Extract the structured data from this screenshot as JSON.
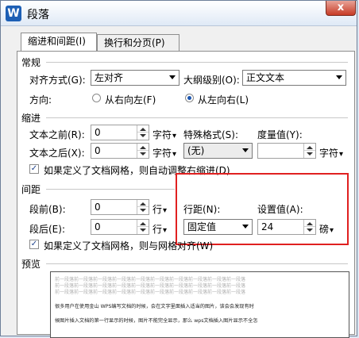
{
  "window": {
    "icon_letter": "W",
    "title": "段落",
    "close_label": "x"
  },
  "tabs": [
    {
      "label": "缩进和间距(I)",
      "active": true
    },
    {
      "label": "换行和分页(P)",
      "active": false
    }
  ],
  "general": {
    "section_label": "常规",
    "align_label": "对齐方式(G):",
    "align_value": "左对齐",
    "outline_label": "大纲级别(O):",
    "outline_value": "正文文本",
    "direction_label": "方向:",
    "rtl_label": "从右向左(F)",
    "ltr_label": "从左向右(L)",
    "direction_selected": "ltr"
  },
  "indent": {
    "section_label": "缩进",
    "before_label": "文本之前(R):",
    "before_value": "0",
    "before_unit": "字符",
    "after_label": "文本之后(X):",
    "after_value": "0",
    "after_unit": "字符",
    "special_label": "特殊格式(S):",
    "special_value": "(无)",
    "measure_label": "度量值(Y):",
    "measure_value": "",
    "measure_unit": "字符",
    "auto_adjust_label": "如果定义了文档网格，则自动调整右缩进(D)",
    "auto_adjust_checked": true
  },
  "spacing": {
    "section_label": "间距",
    "before_label": "段前(B):",
    "before_value": "0",
    "before_unit": "行",
    "after_label": "段后(E):",
    "after_value": "0",
    "after_unit": "行",
    "line_spacing_label": "行距(N):",
    "line_spacing_value": "固定值",
    "set_value_label": "设置值(A):",
    "set_value": "24",
    "set_value_unit": "磅",
    "snap_grid_label": "如果定义了文档网格，则与网格对齐(W)",
    "snap_grid_checked": true
  },
  "preview": {
    "section_label": "预览",
    "prev_paragraph_text": "前一段落前一段落前一段落前一段落前一段落前一段落前一段落前一段落前一段落前一段落",
    "sample_text_1": "很多用户在使用金山 WPS编写文档的时候，会在文字里面插入适当的图片，该会会发现有时",
    "sample_text_2": "候图片插入文档的第一行显示的时候，图片不能完全显示，那么 wps文档插入图片显示不全怎"
  },
  "colors": {
    "highlight_border": "#e02020",
    "accent": "#1b55b0"
  }
}
